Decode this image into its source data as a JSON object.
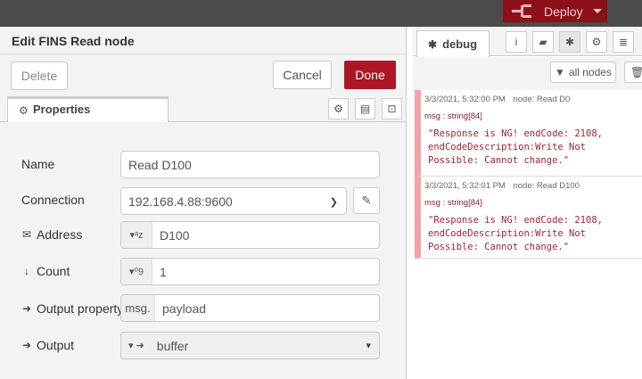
{
  "header": {
    "deploy_label": "Deploy"
  },
  "editor": {
    "title": "Edit FINS Read node",
    "delete_label": "Delete",
    "cancel_label": "Cancel",
    "done_label": "Done",
    "tab_label": "Properties",
    "fields": {
      "name": {
        "label": "Name",
        "value": "Read D100"
      },
      "connection": {
        "label": "Connection",
        "value": "192.168.4.88:9600"
      },
      "address": {
        "label": "Address",
        "prefix": "ᵃz",
        "value": "D100"
      },
      "count": {
        "label": "Count",
        "prefix": "⁰9",
        "value": "1"
      },
      "output_property": {
        "label": "Output property",
        "prefix": "msg.",
        "value": "payload"
      },
      "output": {
        "label": "Output",
        "value": "buffer"
      }
    }
  },
  "sidebar": {
    "tab_label": "debug",
    "filter_label": "all nodes",
    "messages": [
      {
        "timestamp": "3/3/2021, 5:32:00 PM",
        "node": "node: Read D0",
        "type": "msg : string[84]",
        "payload": "\"Response is NG! endCode: 2108, endCodeDescription:Write Not Possible: Cannot change.\""
      },
      {
        "timestamp": "3/3/2021, 5:32:01 PM",
        "node": "node: Read D100",
        "type": "msg : string[84]",
        "payload": "\"Response is NG! endCode: 2108, endCodeDescription:Write Not Possible: Cannot change.\""
      }
    ]
  },
  "colors": {
    "topbar": "#4b4b4b",
    "deploy": "#8c101c",
    "done": "#ad1625",
    "error_border": "#f1a3a3"
  }
}
